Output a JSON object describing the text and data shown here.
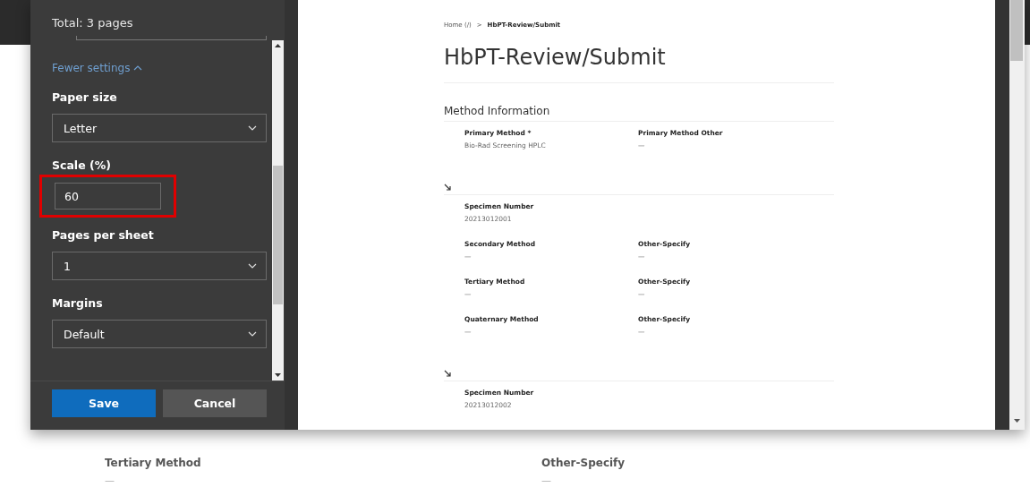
{
  "print_dialog": {
    "summary": "Total: 3 pages",
    "toggle": {
      "label": "Fewer settings",
      "expanded": true
    },
    "settings": [
      {
        "kind": "select",
        "label": "Paper size",
        "value": "Letter"
      },
      {
        "kind": "input",
        "label": "Scale (%)",
        "value": "60",
        "highlighted": true
      },
      {
        "kind": "select",
        "label": "Pages per sheet",
        "value": "1"
      },
      {
        "kind": "select",
        "label": "Margins",
        "value": "Default"
      }
    ],
    "buttons": [
      {
        "label": "Save",
        "primary": true
      },
      {
        "label": "Cancel",
        "primary": false
      }
    ]
  },
  "preview": {
    "breadcrumb": {
      "link": "Home (/)",
      "separator": ">",
      "current": "HbPT-Review/Submit"
    },
    "title": "HbPT-Review/Submit",
    "section": "Method Information",
    "primary_fields": [
      {
        "label": "Primary Method *",
        "value": "Bio-Rad Screening HPLC"
      },
      {
        "label": "Primary Method Other",
        "value": "—"
      }
    ],
    "specimens": [
      {
        "number_label": "Specimen Number",
        "number": "20213012001",
        "rows": [
          [
            {
              "label": "Secondary Method",
              "value": "—"
            },
            {
              "label": "Other-Specify",
              "value": "—"
            }
          ],
          [
            {
              "label": "Tertiary Method",
              "value": "—"
            },
            {
              "label": "Other-Specify",
              "value": "—"
            }
          ],
          [
            {
              "label": "Quaternary Method",
              "value": "—"
            },
            {
              "label": "Other-Specify",
              "value": "—"
            }
          ]
        ]
      },
      {
        "number_label": "Specimen Number",
        "number": "20213012002"
      }
    ]
  },
  "background_page": {
    "fields": [
      {
        "label": "Tertiary Method",
        "value": "—"
      },
      {
        "label": "Other-Specify",
        "value": "—"
      }
    ]
  }
}
